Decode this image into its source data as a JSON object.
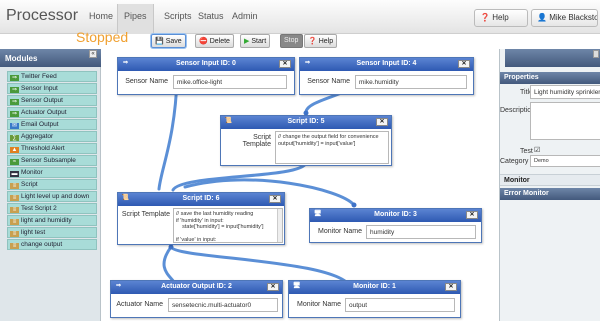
{
  "nav": {
    "brand": "Processor",
    "items": [
      "Home",
      "Pipes",
      "Scripts",
      "Status",
      "Admin"
    ],
    "help": "Help",
    "user": "Mike Blackstock"
  },
  "toolbar": {
    "status": "Stopped",
    "save": "Save",
    "delete": "Delete",
    "start": "Start",
    "stop": "Stop",
    "help": "Help"
  },
  "sidebar": {
    "title": "Modules",
    "collapse": "«",
    "modules": [
      "Twitter Feed",
      "Sensor Input",
      "Sensor Output",
      "Actuator Output",
      "Email Output",
      "Aggregator",
      "Threshold Alert",
      "Sensor Subsample",
      "Monitor",
      "Script",
      "Light level up and down",
      "Test Script 2",
      "light and humidity",
      "light test",
      "change output"
    ]
  },
  "nodes": {
    "sensor0": {
      "title": "Sensor Input ID: 0",
      "label": "Sensor Name",
      "value": "mike.office-light"
    },
    "sensor4": {
      "title": "Sensor Input ID: 4",
      "label": "Sensor Name",
      "value": "mike.humidity"
    },
    "script5": {
      "title": "Script ID: 5",
      "label": "Script Template",
      "value": "// change the output field for convenience\noutput['humidity'] = input['value']"
    },
    "script6": {
      "title": "Script ID: 6",
      "label": "Script Template",
      "value": "// save the last humidity reading\nif 'humidity' in input:\n    state['humidity'] = input['humidity']\n\nif 'value' in input:\n    if 'humidity' in state:"
    },
    "monitor3": {
      "title": "Monitor ID: 3",
      "label": "Monitor Name",
      "value": "humidity"
    },
    "actuator2": {
      "title": "Actuator Output ID: 2",
      "label": "Actuator Name",
      "value": "sensetecnic.multi-actuator0"
    },
    "monitor1": {
      "title": "Monitor ID: 1",
      "label": "Monitor Name",
      "value": "output"
    }
  },
  "close_label": "✕",
  "properties": {
    "title": "Properties",
    "title_label": "Title",
    "title_value": "Light humidity sprinkler",
    "description_label": "Descriptio",
    "test_label": "Test",
    "category_label": "Category",
    "category_value": "Demo",
    "monitor": "Monitor",
    "error_monitor": "Error Monitor"
  }
}
